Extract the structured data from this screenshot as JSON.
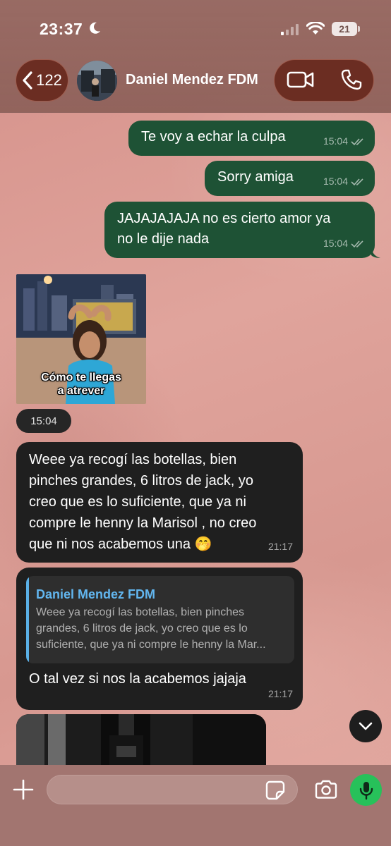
{
  "status_bar": {
    "time": "23:37",
    "battery": "21",
    "icons": [
      "moon-icon",
      "cellular-signal-icon",
      "wifi-icon",
      "battery-icon"
    ]
  },
  "header": {
    "back_count": "122",
    "contact_name": "Daniel Mendez FDM",
    "actions": [
      "video-call-icon",
      "voice-call-icon"
    ]
  },
  "messages": [
    {
      "direction": "out",
      "text": "Te voy a echar la culpa",
      "time": "15:04",
      "read": true
    },
    {
      "direction": "out",
      "text": "Sorry amiga",
      "time": "15:04",
      "read": true
    },
    {
      "direction": "out",
      "text_lines": [
        "JAJAJAJAJA no es cierto amor ya",
        "no le dije nada"
      ],
      "time": "15:04",
      "read": true
    },
    {
      "direction": "in",
      "type": "sticker",
      "caption_lines": [
        "Cómo te llegas",
        "a atrever"
      ],
      "time": "15:04"
    },
    {
      "direction": "in",
      "text_lines": [
        "Weee ya recogí las botellas, bien",
        "pinches grandes, 6 litros de jack, yo",
        "creo que es lo suficiente, que ya ni",
        "compre le henny la Marisol , no creo",
        "que ni nos acabemos una 🤭"
      ],
      "time": "21:17"
    },
    {
      "direction": "in",
      "type": "reply",
      "quoted_name": "Daniel Mendez FDM",
      "quoted_lines": [
        "Weee ya recogí las botellas, bien pinches",
        "grandes, 6 litros de jack, yo creo que es lo",
        "suficiente, que ya ni compre le henny la Mar..."
      ],
      "text": "O tal vez si nos la acabemos jajaja",
      "time": "21:17"
    },
    {
      "direction": "in",
      "type": "photo"
    }
  ],
  "composer": {
    "placeholder": "",
    "icons": [
      "plus-icon",
      "sticker-icon",
      "camera-icon",
      "microphone-icon"
    ]
  },
  "colors": {
    "outgoing_bubble": "#1e5235",
    "incoming_bubble": "#1f1f1f",
    "reply_accent": "#62b6ef",
    "mic_button": "#27c15a",
    "header_pill": "#6b2d22"
  }
}
